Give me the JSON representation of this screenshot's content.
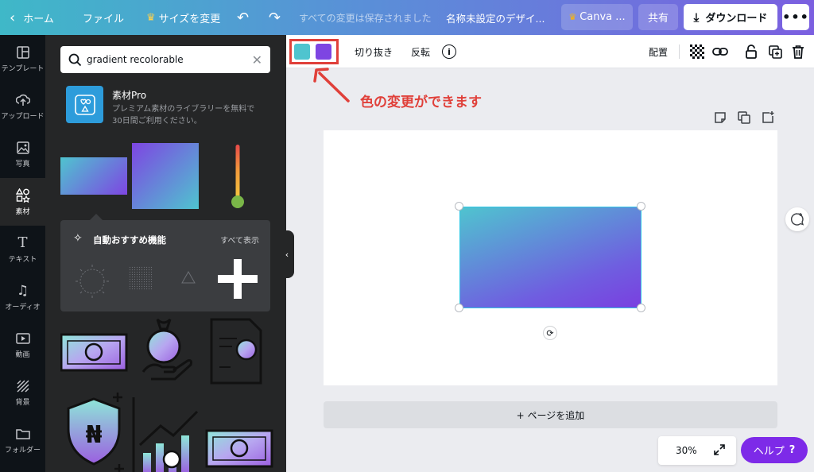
{
  "topbar": {
    "home_label": "ホーム",
    "file_label": "ファイル",
    "resize_label": "サイズを変更",
    "saved_status": "すべての変更は保存されました",
    "design_title": "名称未設定のデザイ...",
    "canva_pro_label": "Canva ...",
    "share_label": "共有",
    "download_label": "ダウンロード"
  },
  "rail": {
    "items": [
      {
        "label": "テンプレート",
        "icon": "template-icon"
      },
      {
        "label": "アップロード",
        "icon": "upload-icon"
      },
      {
        "label": "写真",
        "icon": "photo-icon"
      },
      {
        "label": "素材",
        "icon": "elements-icon"
      },
      {
        "label": "テキスト",
        "icon": "text-icon"
      },
      {
        "label": "オーディオ",
        "icon": "audio-icon"
      },
      {
        "label": "動画",
        "icon": "video-icon"
      },
      {
        "label": "背景",
        "icon": "background-icon"
      },
      {
        "label": "フォルダー",
        "icon": "folder-icon"
      }
    ]
  },
  "panel": {
    "search_value": "gradient recolorable",
    "pro_title": "素材Pro",
    "pro_desc_1": "プレミアム素材のライブラリーを無料で",
    "pro_desc_2": "30日間ご利用ください。",
    "recommend_title": "自動おすすめ機能",
    "see_all": "すべて表示"
  },
  "toolbar": {
    "color_1": "#4fc4cf",
    "color_2": "#7e45e2",
    "crop_label": "切り抜き",
    "flip_label": "反転",
    "position_label": "配置"
  },
  "annotation": {
    "text": "色の変更ができます",
    "color": "#e0403a"
  },
  "canvas": {
    "add_page_label": "+ ページを追加",
    "zoom_value": "30%"
  },
  "help": {
    "label": "ヘルプ",
    "mark": "?"
  },
  "colors": {
    "accent": "#7d2ae8",
    "highlight": "#e0403a"
  }
}
